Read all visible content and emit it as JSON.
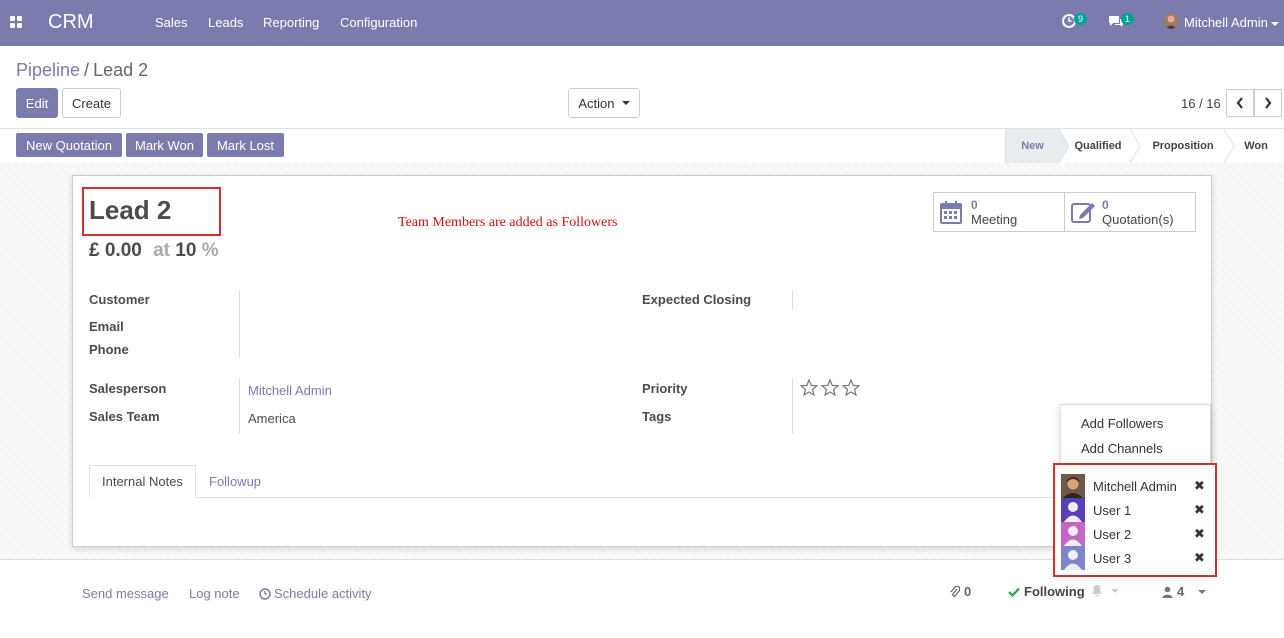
{
  "navbar": {
    "brand": "CRM",
    "menu": [
      "Sales",
      "Leads",
      "Reporting",
      "Configuration"
    ],
    "activity_count": "9",
    "message_count": "1",
    "user_name": "Mitchell Admin"
  },
  "breadcrumb": {
    "parent": "Pipeline",
    "separator": "/",
    "current": "Lead 2"
  },
  "control_panel": {
    "edit_label": "Edit",
    "create_label": "Create",
    "action_label": "Action",
    "pager": "16 / 16"
  },
  "statusbar": {
    "buttons": [
      "New Quotation",
      "Mark Won",
      "Mark Lost"
    ],
    "stages": [
      "New",
      "Qualified",
      "Proposition",
      "Won"
    ],
    "active_stage": "New"
  },
  "lead": {
    "title": "Lead 2",
    "revenue": "£ 0.00",
    "at_label": "at",
    "probability": "10",
    "percent_symbol": "%",
    "annotation": "Team Members are added as Followers"
  },
  "smart_buttons": [
    {
      "count": "0",
      "label": "Meeting",
      "icon": "calendar-icon"
    },
    {
      "count": "0",
      "label": "Quotation(s)",
      "icon": "edit-icon"
    }
  ],
  "fields": {
    "customer_label": "Customer",
    "email_label": "Email",
    "phone_label": "Phone",
    "expected_closing_label": "Expected Closing",
    "salesperson_label": "Salesperson",
    "salesperson_value": "Mitchell Admin",
    "sales_team_label": "Sales Team",
    "sales_team_value": "America",
    "priority_label": "Priority",
    "priority_stars": 0,
    "tags_label": "Tags"
  },
  "tabs": [
    "Internal Notes",
    "Followup"
  ],
  "chatter": {
    "send_message": "Send message",
    "log_note": "Log note",
    "schedule_activity": "Schedule activity",
    "attachments_count": "0",
    "following_label": "Following",
    "followers_count": "4"
  },
  "followers_menu": {
    "add_followers": "Add Followers",
    "add_channels": "Add Channels",
    "followers": [
      "Mitchell Admin",
      "User 1",
      "User 2",
      "User 3"
    ]
  },
  "colors": {
    "brand": "#7c7bad",
    "badge": "#00a09d",
    "highlight": "#d32f2f",
    "following": "#28a745"
  }
}
